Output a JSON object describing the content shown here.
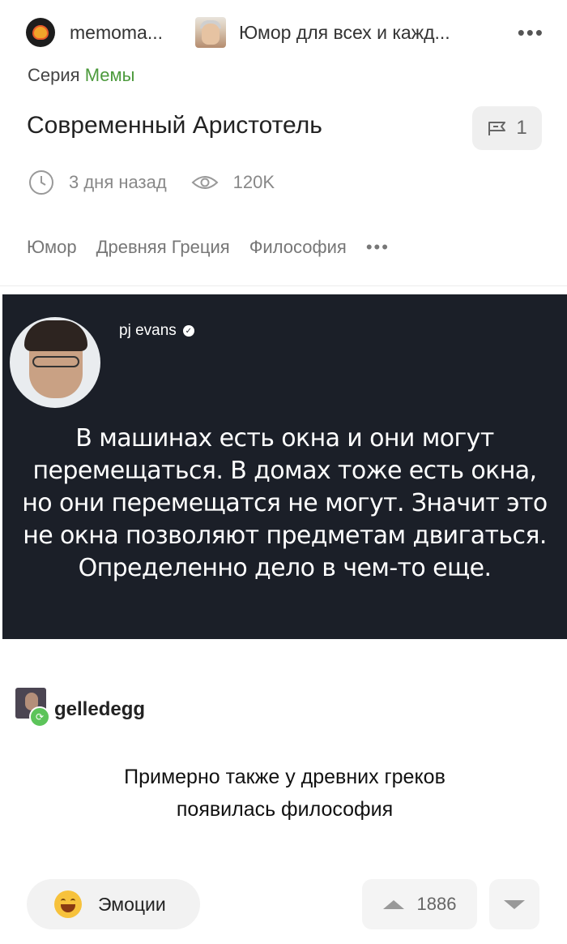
{
  "header": {
    "author_name": "memoma...",
    "community_name": "Юмор для всех и кажд...",
    "more": "•••"
  },
  "series": {
    "label": "Серия",
    "link": "Мемы"
  },
  "post": {
    "title": "Современный Аристотель",
    "saves_count": "1",
    "time_ago": "3 дня назад",
    "views": "120K",
    "tags": [
      "Юмор",
      "Древняя Греция",
      "Философия"
    ],
    "tags_more": "•••"
  },
  "image": {
    "tweet_author": "pj evans",
    "tweet_lines": [
      "В машинах есть окна и они могут",
      "перемещаться. В домах тоже есть окна,",
      "но они перемещатся не могут. Значит это",
      "не окна позволяют предметам двигаться.",
      "Определенно дело в чем-то еще."
    ],
    "reply_author": "gelledegg",
    "reply_lines": [
      "Примерно также у древних греков",
      "появилась философия"
    ]
  },
  "footer": {
    "emotions_label": "Эмоции",
    "rating": "1886"
  },
  "colors": {
    "series_link": "#4c9a3c",
    "tweet_bg": "#1b1f28",
    "button_bg": "#f2f2f2"
  }
}
